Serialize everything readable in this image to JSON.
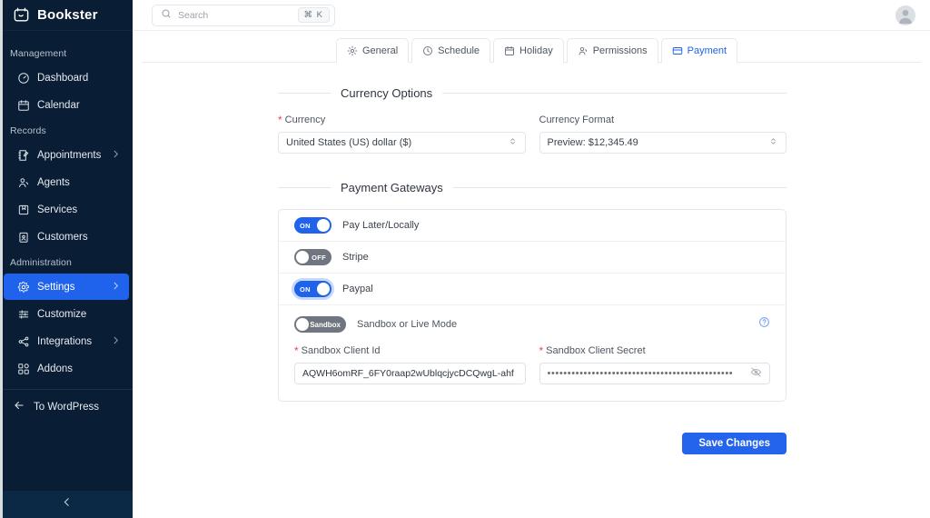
{
  "sidebar": {
    "brand": "Bookster",
    "brand_logo_icon": "calendar-smile-icon",
    "sections": [
      {
        "label": "Management",
        "items": [
          {
            "label": "Dashboard",
            "icon": "speedometer-icon",
            "active": false,
            "chevron": false
          },
          {
            "label": "Calendar",
            "icon": "calendar-icon",
            "active": false,
            "chevron": false
          }
        ]
      },
      {
        "label": "Records",
        "items": [
          {
            "label": "Appointments",
            "icon": "notebook-pen-icon",
            "active": false,
            "chevron": true
          },
          {
            "label": "Agents",
            "icon": "user-group-icon",
            "active": false,
            "chevron": false
          },
          {
            "label": "Services",
            "icon": "bookmark-box-icon",
            "active": false,
            "chevron": false
          },
          {
            "label": "Customers",
            "icon": "contact-card-icon",
            "active": false,
            "chevron": false
          }
        ]
      },
      {
        "label": "Administration",
        "items": [
          {
            "label": "Settings",
            "icon": "gear-icon",
            "active": true,
            "chevron": true
          },
          {
            "label": "Customize",
            "icon": "sliders-icon",
            "active": false,
            "chevron": false
          },
          {
            "label": "Integrations",
            "icon": "share-nodes-icon",
            "active": false,
            "chevron": true
          },
          {
            "label": "Addons",
            "icon": "blocks-icon",
            "active": false,
            "chevron": false
          }
        ]
      }
    ],
    "to_wordpress": "To WordPress",
    "collapse_icon": "chevron-left-icon",
    "active_color": "#1F62EB",
    "background_color": "#091D34"
  },
  "topbar": {
    "search_placeholder": "Search",
    "search_value": "",
    "search_icon": "search-icon",
    "shortcut_badge": "⌘ K",
    "avatar_icon": "user-avatar-icon"
  },
  "tabs": [
    {
      "label": "General",
      "icon": "gear-icon",
      "active": false
    },
    {
      "label": "Schedule",
      "icon": "clock-icon",
      "active": false
    },
    {
      "label": "Holiday",
      "icon": "calendar-icon",
      "active": false
    },
    {
      "label": "Permissions",
      "icon": "user-check-icon",
      "active": false
    },
    {
      "label": "Payment",
      "icon": "credit-card-icon",
      "active": true
    }
  ],
  "currency_section": {
    "title": "Currency Options",
    "currency": {
      "label": "Currency",
      "required": true,
      "value": "United States (US) dollar ($)"
    },
    "currency_format": {
      "label": "Currency Format",
      "required": false,
      "value": "Preview: $12,345.49"
    }
  },
  "gateways_section": {
    "title": "Payment Gateways",
    "rows": [
      {
        "label": "Pay Later/Locally",
        "state": "ON",
        "on": true,
        "focused": false
      },
      {
        "label": "Stripe",
        "state": "OFF",
        "on": false,
        "focused": false
      },
      {
        "label": "Paypal",
        "state": "ON",
        "on": true,
        "focused": true
      }
    ],
    "paypal_panel": {
      "mode_toggle_label": "Sandbox",
      "mode_toggle_on": false,
      "mode_hint": "Sandbox or Live Mode",
      "help_icon": "question-circle-icon",
      "client_id": {
        "label": "Sandbox Client Id",
        "required": true,
        "value": "AQWH6omRF_6FY0raap2wUblqcjycDCQwgL-ahf"
      },
      "client_secret": {
        "label": "Sandbox Client Secret",
        "required": true,
        "masked_value": "••••••••••••••••••••••••••••••••••••••••••••••",
        "visibility_icon": "eye-slash-icon"
      }
    }
  },
  "footer": {
    "save_label": "Save Changes",
    "save_color": "#2463EB"
  }
}
